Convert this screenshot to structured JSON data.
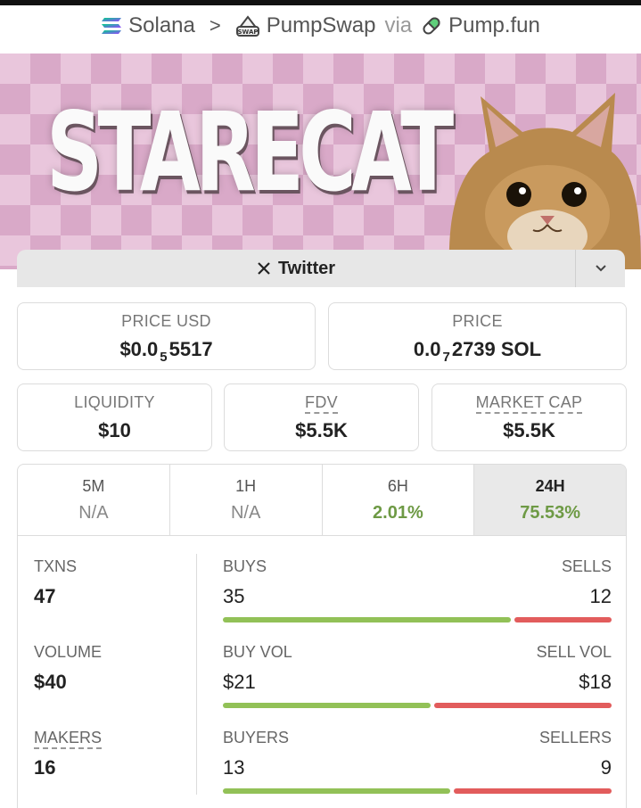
{
  "breadcrumb": {
    "chain": "Solana",
    "sep": ">",
    "dex": "PumpSwap",
    "dex_badge": "SWAP",
    "via": "via",
    "launchpad": "Pump.fun"
  },
  "banner": {
    "title": "STARECAT"
  },
  "twitter": {
    "label": "Twitter"
  },
  "price_usd": {
    "label": "PRICE USD",
    "prefix": "$0.0",
    "zeros": "5",
    "digits": "5517"
  },
  "price_native": {
    "label": "PRICE",
    "prefix": "0.0",
    "zeros": "7",
    "digits": "2739 SOL"
  },
  "liquidity": {
    "label": "LIQUIDITY",
    "value": "$10"
  },
  "fdv": {
    "label": "FDV",
    "value": "$5.5K"
  },
  "market_cap": {
    "label": "MARKET CAP",
    "value": "$5.5K"
  },
  "tabs": [
    {
      "label": "5M",
      "value": "N/A"
    },
    {
      "label": "1H",
      "value": "N/A"
    },
    {
      "label": "6H",
      "value": "2.01%"
    },
    {
      "label": "24H",
      "value": "75.53%"
    }
  ],
  "txns": {
    "label": "TXNS",
    "value": "47",
    "left_label": "BUYS",
    "left_value": "35",
    "right_label": "SELLS",
    "right_value": "12",
    "buy_share": 0.745
  },
  "volume": {
    "label": "VOLUME",
    "value": "$40",
    "left_label": "BUY VOL",
    "left_value": "$21",
    "right_label": "SELL VOL",
    "right_value": "$18",
    "buy_share": 0.54
  },
  "makers": {
    "label": "MAKERS",
    "value": "16",
    "left_label": "BUYERS",
    "left_value": "13",
    "right_label": "SELLERS",
    "right_value": "9",
    "buy_share": 0.59
  },
  "colors": {
    "positive": "#6e9a45",
    "buy_bar": "#92c157",
    "sell_bar": "#e25c5c"
  }
}
